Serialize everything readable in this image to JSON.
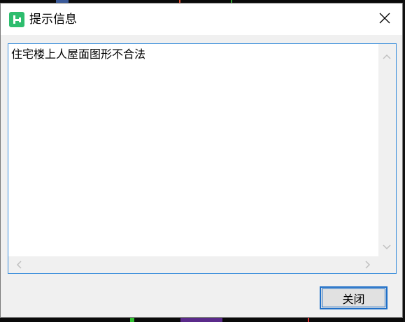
{
  "dialog": {
    "title": "提示信息",
    "app_icon": "hammer-app-icon",
    "close_icon": "close-icon",
    "message": "住宅楼上人屋面图形不合法",
    "close_button_label": "关闭"
  },
  "colors": {
    "accent": "#1e6fc8",
    "focus_border": "#3c8fdc",
    "icon_green": "#2dbd6e",
    "dialog_bg": "#f0f0f0"
  }
}
